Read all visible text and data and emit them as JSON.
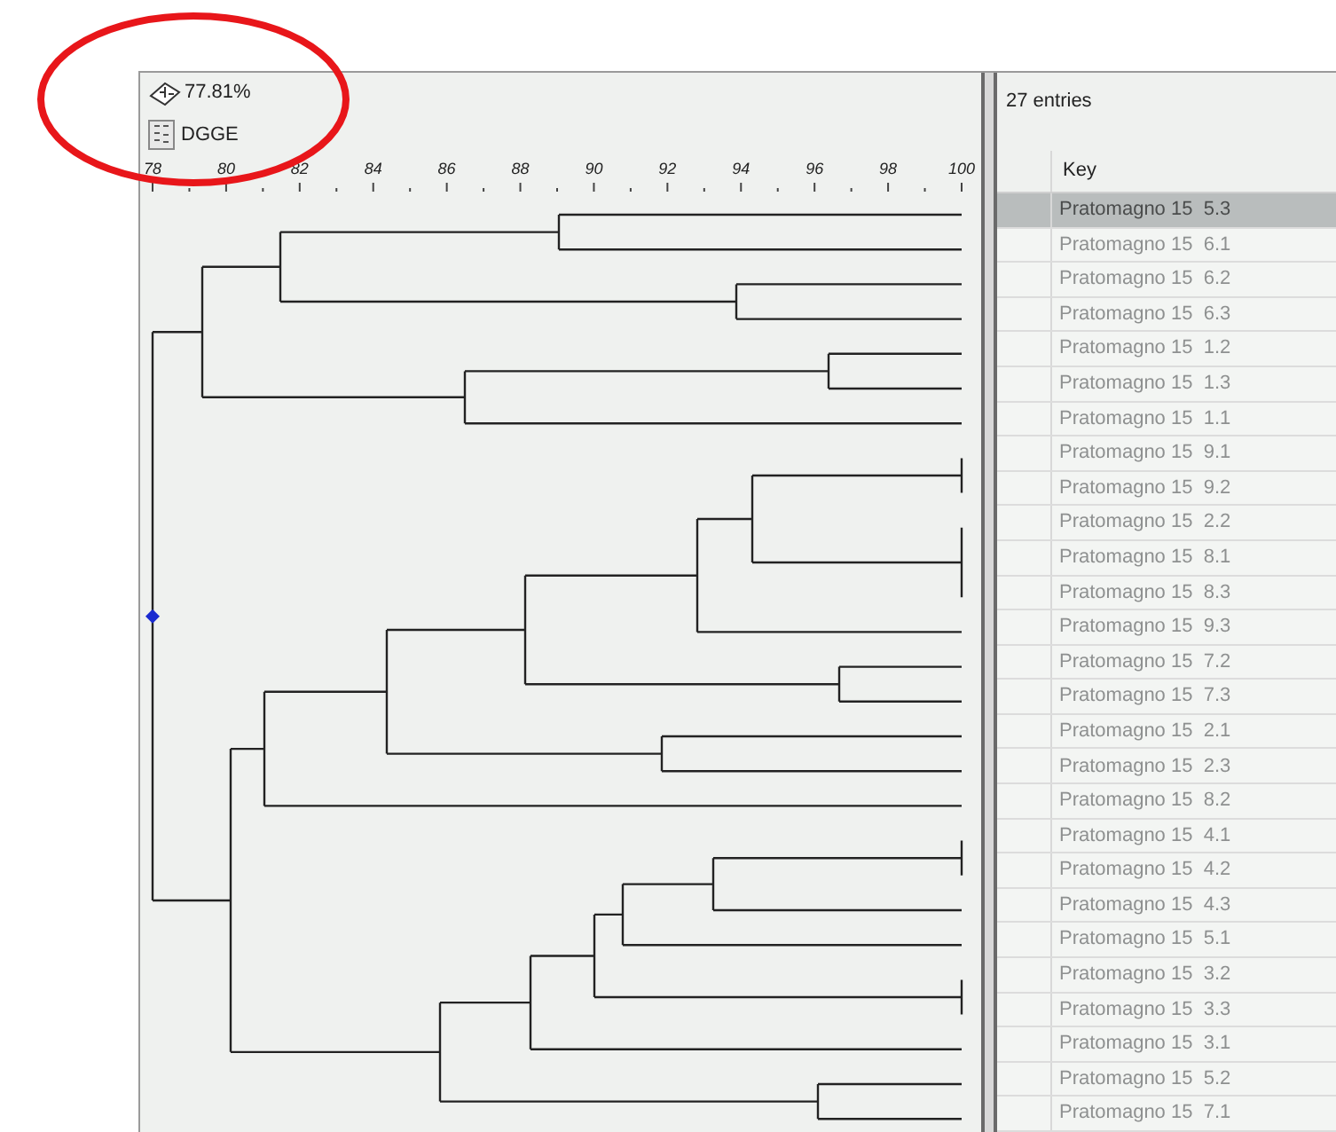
{
  "toolbar": {
    "similarity": "77.81%",
    "experiment": "DGGE"
  },
  "ruler": {
    "ticks": [
      "78",
      "80",
      "82",
      "84",
      "86",
      "88",
      "90",
      "92",
      "94",
      "96",
      "98",
      "100"
    ]
  },
  "list": {
    "count": "27 entries",
    "column": "Key",
    "rows": [
      {
        "key": "Pratomagno 15  5.3",
        "selected": true
      },
      {
        "key": "Pratomagno 15  6.1",
        "selected": false
      },
      {
        "key": "Pratomagno 15  6.2",
        "selected": false
      },
      {
        "key": "Pratomagno 15  6.3",
        "selected": false
      },
      {
        "key": "Pratomagno 15  1.2",
        "selected": false
      },
      {
        "key": "Pratomagno 15  1.3",
        "selected": false
      },
      {
        "key": "Pratomagno 15  1.1",
        "selected": false
      },
      {
        "key": "Pratomagno 15  9.1",
        "selected": false
      },
      {
        "key": "Pratomagno 15  9.2",
        "selected": false
      },
      {
        "key": "Pratomagno 15  2.2",
        "selected": false
      },
      {
        "key": "Pratomagno 15  8.1",
        "selected": false
      },
      {
        "key": "Pratomagno 15  8.3",
        "selected": false
      },
      {
        "key": "Pratomagno 15  9.3",
        "selected": false
      },
      {
        "key": "Pratomagno 15  7.2",
        "selected": false
      },
      {
        "key": "Pratomagno 15  7.3",
        "selected": false
      },
      {
        "key": "Pratomagno 15  2.1",
        "selected": false
      },
      {
        "key": "Pratomagno 15  2.3",
        "selected": false
      },
      {
        "key": "Pratomagno 15  8.2",
        "selected": false
      },
      {
        "key": "Pratomagno 15  4.1",
        "selected": false
      },
      {
        "key": "Pratomagno 15  4.2",
        "selected": false
      },
      {
        "key": "Pratomagno 15  4.3",
        "selected": false
      },
      {
        "key": "Pratomagno 15  5.1",
        "selected": false
      },
      {
        "key": "Pratomagno 15  3.2",
        "selected": false
      },
      {
        "key": "Pratomagno 15  3.3",
        "selected": false
      },
      {
        "key": "Pratomagno 15  3.1",
        "selected": false
      },
      {
        "key": "Pratomagno 15  5.2",
        "selected": false
      },
      {
        "key": "Pratomagno 15  7.1",
        "selected": false
      }
    ]
  }
}
